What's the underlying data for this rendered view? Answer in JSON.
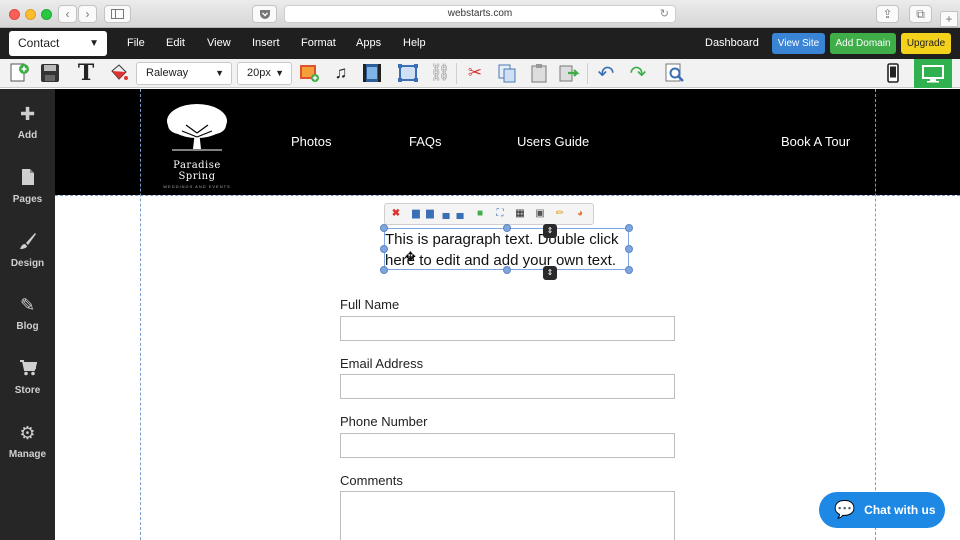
{
  "browser": {
    "url": "webstarts.com",
    "reload_icon": "reload-icon"
  },
  "menubar": {
    "page_selector": "Contact",
    "menus": [
      "File",
      "Edit",
      "View",
      "Insert",
      "Format",
      "Apps",
      "Help"
    ],
    "dashboard": "Dashboard",
    "view_site": "View Site",
    "add_domain": "Add Domain",
    "upgrade": "Upgrade",
    "colors": {
      "view_site": "#3a84d6",
      "add_domain": "#3fae49",
      "upgrade": "#f4d21c"
    }
  },
  "toolbar": {
    "font": "Raleway",
    "size": "20px"
  },
  "sidebar": {
    "items": [
      {
        "label": "Add",
        "icon": "plus-icon"
      },
      {
        "label": "Pages",
        "icon": "page-icon"
      },
      {
        "label": "Design",
        "icon": "brush-icon"
      },
      {
        "label": "Blog",
        "icon": "pencil-icon"
      },
      {
        "label": "Store",
        "icon": "cart-icon"
      },
      {
        "label": "Manage",
        "icon": "gear-icon"
      }
    ]
  },
  "site": {
    "logo_name": "Paradise Spring",
    "logo_sub": "WEDDINGS AND EVENTS",
    "nav": [
      "Photos",
      "FAQs",
      "Users Guide",
      "Book A Tour"
    ]
  },
  "paragraph": {
    "line1": "This is paragraph text. Double click",
    "line2": "here to edit and add your own text."
  },
  "form": {
    "fields": [
      {
        "label": "Full Name"
      },
      {
        "label": "Email Address"
      },
      {
        "label": "Phone Number"
      },
      {
        "label": "Comments"
      }
    ]
  },
  "chat": {
    "label": "Chat with us"
  }
}
